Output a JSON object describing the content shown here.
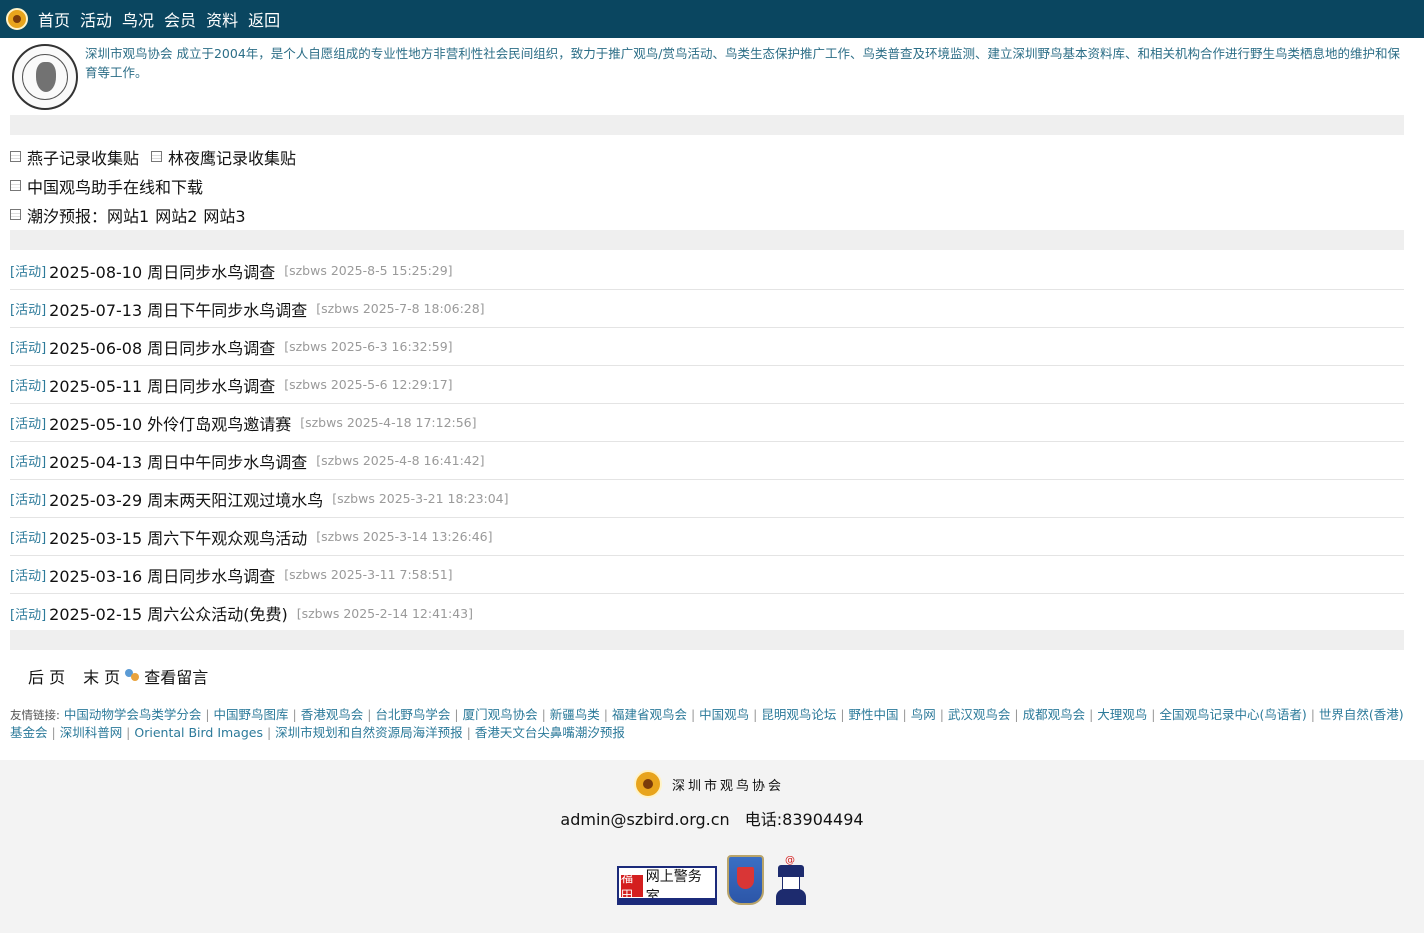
{
  "nav": {
    "items": [
      "首页",
      "活动",
      "鸟况",
      "会员",
      "资料",
      "返回"
    ]
  },
  "intro": {
    "text": "深圳市观鸟协会 成立于2004年，是个人自愿组成的专业性地方非营利性社会民间组织，致力于推广观鸟/赏鸟活动、鸟类生态保护推广工作、鸟类普查及环境监测、建立深圳野鸟基本资料库、和相关机构合作进行野生鸟类栖息地的维护和保育等工作。"
  },
  "quick_links": {
    "swallow": "燕子记录收集贴",
    "nightjar": "林夜鹰记录收集贴",
    "assistant": "中国观鸟助手在线和下载",
    "tide_label": "潮汐预报：",
    "tide_sites": [
      "网站1",
      "网站2",
      "网站3"
    ]
  },
  "news": [
    {
      "cat": "[活动]",
      "title": "2025-08-10 周日同步水鸟调查",
      "meta": "[szbws 2025-8-5 15:25:29]"
    },
    {
      "cat": "[活动]",
      "title": "2025-07-13 周日下午同步水鸟调查",
      "meta": "[szbws 2025-7-8 18:06:28]"
    },
    {
      "cat": "[活动]",
      "title": "2025-06-08 周日同步水鸟调查",
      "meta": "[szbws 2025-6-3 16:32:59]"
    },
    {
      "cat": "[活动]",
      "title": "2025-05-11 周日同步水鸟调查",
      "meta": "[szbws 2025-5-6 12:29:17]"
    },
    {
      "cat": "[活动]",
      "title": "2025-05-10 外伶仃岛观鸟邀请赛",
      "meta": "[szbws 2025-4-18 17:12:56]"
    },
    {
      "cat": "[活动]",
      "title": "2025-04-13 周日中午同步水鸟调查",
      "meta": "[szbws 2025-4-8 16:41:42]"
    },
    {
      "cat": "[活动]",
      "title": "2025-03-29 周末两天阳江观过境水鸟",
      "meta": "[szbws 2025-3-21 18:23:04]"
    },
    {
      "cat": "[活动]",
      "title": "2025-03-15 周六下午观众观鸟活动",
      "meta": "[szbws 2025-3-14 13:26:46]"
    },
    {
      "cat": "[活动]",
      "title": "2025-03-16 周日同步水鸟调查",
      "meta": "[szbws 2025-3-11 7:58:51]"
    },
    {
      "cat": "[活动]",
      "title": "2025-02-15 周六公众活动(免费)",
      "meta": "[szbws 2025-2-14 12:41:43]"
    }
  ],
  "pager": {
    "next": "后 页",
    "last": "末 页",
    "guestbook": "查看留言"
  },
  "friends": {
    "label": "友情链接:",
    "links": [
      "中国动物学会鸟类学分会",
      "中国野鸟图库",
      "香港观鸟会",
      "台北野鸟学会",
      "厦门观鸟协会",
      "新疆鸟类",
      "福建省观鸟会",
      "中国观鸟",
      "昆明观鸟论坛",
      "野性中国",
      "鸟网",
      "武汉观鸟会",
      "成都观鸟会",
      "大理观鸟",
      "全国观鸟记录中心(鸟语者)",
      "世界自然(香港)基金会",
      "深圳科普网",
      "Oriental Bird Images",
      "深圳市规划和自然资源局海洋预报",
      "香港天文台尖鼻嘴潮汐预报"
    ]
  },
  "footer": {
    "brand": "深圳市观鸟协会",
    "email": "admin@szbird.org.cn",
    "phone": "电话:83904494",
    "police_badge_red": "福田",
    "police_badge_text": "网上警务室"
  },
  "colors": {
    "nav_bg": "#0a4660",
    "link": "#2c7a9a",
    "intro_text": "#2c6e87",
    "meta": "#9a9a9a",
    "bar": "#efefef"
  }
}
